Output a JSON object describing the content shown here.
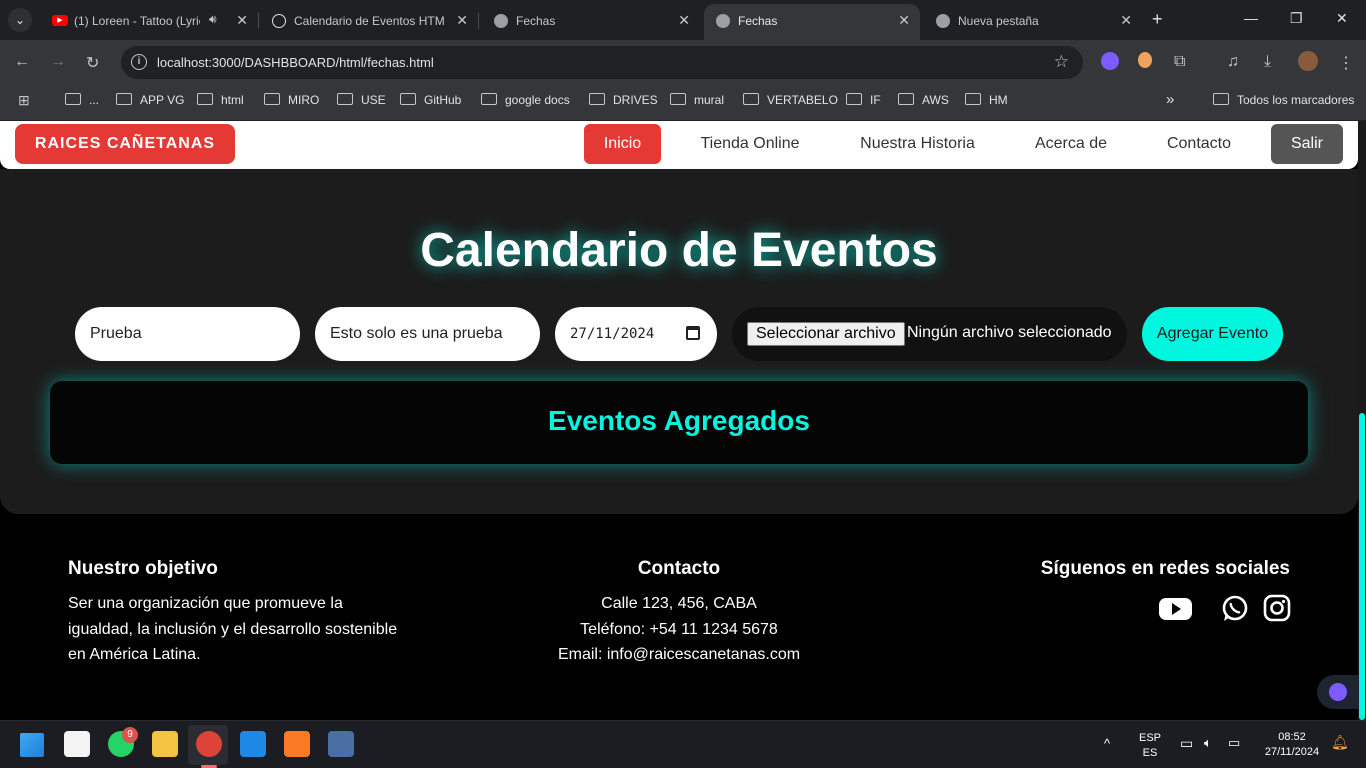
{
  "browser": {
    "tabs": [
      {
        "title": "(1) Loreen - Tattoo (Lyric",
        "favicon": "youtube-icon",
        "color": "#ff0000"
      },
      {
        "title": "Calendario de Eventos HTM",
        "favicon": "openai-icon",
        "color": "#1f2023"
      },
      {
        "title": "Fechas",
        "favicon": "globe-icon",
        "color": "#1f2023"
      },
      {
        "title": "Fechas",
        "favicon": "globe-icon",
        "color": "#35363a"
      },
      {
        "title": "Nueva pestaña",
        "favicon": "chrome-icon",
        "color": "#1f2023"
      }
    ],
    "url": "localhost:3000/DASHBBOARD/html/fechas.html",
    "bookmarks": [
      "...",
      "APP VG",
      "html",
      "MIRO",
      "USE",
      "GitHub",
      "google docs",
      "DRIVES",
      "mural",
      "VERTABELO",
      "IF",
      "AWS",
      "HM"
    ],
    "all_bookmarks_label": "Todos los marcadores",
    "more_bookmarks": "»"
  },
  "navbar": {
    "brand": "RAICES CAÑETANAS",
    "items": [
      "Inicio",
      "Tienda Online",
      "Nuestra Historia",
      "Acerca de",
      "Contacto"
    ],
    "logout": "Salir",
    "accent": "#e53935"
  },
  "main": {
    "title": "Calendario de Eventos",
    "name_value": "Prueba",
    "description_value": "Esto solo es una prueba",
    "date_value": "27/11/2024",
    "file_button": "Seleccionar archivo",
    "file_status": "Ningún archivo seleccionado",
    "add_button": "Agregar Evento",
    "events_title": "Eventos Agregados",
    "accent": "#00f7df"
  },
  "footer": {
    "objective_title": "Nuestro objetivo",
    "objective_lines": [
      "Ser una organización que promueve la",
      "igualdad, la inclusión y el desarrollo sostenible",
      "en América Latina."
    ],
    "contact_title": "Contacto",
    "contact_lines": [
      "Calle 123, 456, CABA",
      "Teléfono: +54 11 1234 5678",
      "Email: info@raicescanetanas.com"
    ],
    "social_title": "Síguenos en redes sociales",
    "social_icons": [
      "youtube-icon",
      "whatsapp-icon",
      "instagram-icon"
    ]
  },
  "taskbar": {
    "whatsapp_badge": "9",
    "lang_top": "ESP",
    "lang_bottom": "ES",
    "time": "08:52",
    "date": "27/11/2024"
  }
}
